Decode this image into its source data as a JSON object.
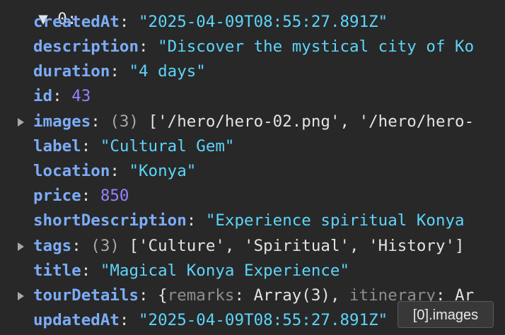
{
  "header_fragment": "▼ 0:",
  "props": {
    "createdAt": {
      "key": "createdAt",
      "value": "\"2025-04-09T08:55:27.891Z\""
    },
    "description": {
      "key": "description",
      "value": "\"Discover the mystical city of Ko"
    },
    "duration": {
      "key": "duration",
      "value": "\"4 days\""
    },
    "id": {
      "key": "id",
      "value": "43"
    },
    "images": {
      "key": "images",
      "count": "(3)",
      "preview": "['/hero/hero-02.png', '/hero/hero-"
    },
    "label": {
      "key": "label",
      "value": "\"Cultural Gem\""
    },
    "location": {
      "key": "location",
      "value": "\"Konya\""
    },
    "price": {
      "key": "price",
      "value": "850"
    },
    "shortDescription": {
      "key": "shortDescription",
      "value": "\"Experience spiritual Konya"
    },
    "tags": {
      "key": "tags",
      "count": "(3)",
      "preview": "['Culture', 'Spiritual', 'History']"
    },
    "title": {
      "key": "title",
      "value": "\"Magical Konya Experience\""
    },
    "tourDetails": {
      "key": "tourDetails",
      "open": "{",
      "sub1_key": "remarks",
      "sub1_val": "Array(3)",
      "sub2_key": "itinerary",
      "sub2_val": "Ar"
    },
    "updatedAt": {
      "key": "updatedAt",
      "value": "\"2025-04-09T08:55:27.891Z\""
    }
  },
  "tooltip": "[0].images",
  "colors": {
    "background": "#282828",
    "key": "#7cacf8",
    "string": "#5cd5fb",
    "number": "#9980ff",
    "count": "#a8a8a8"
  }
}
